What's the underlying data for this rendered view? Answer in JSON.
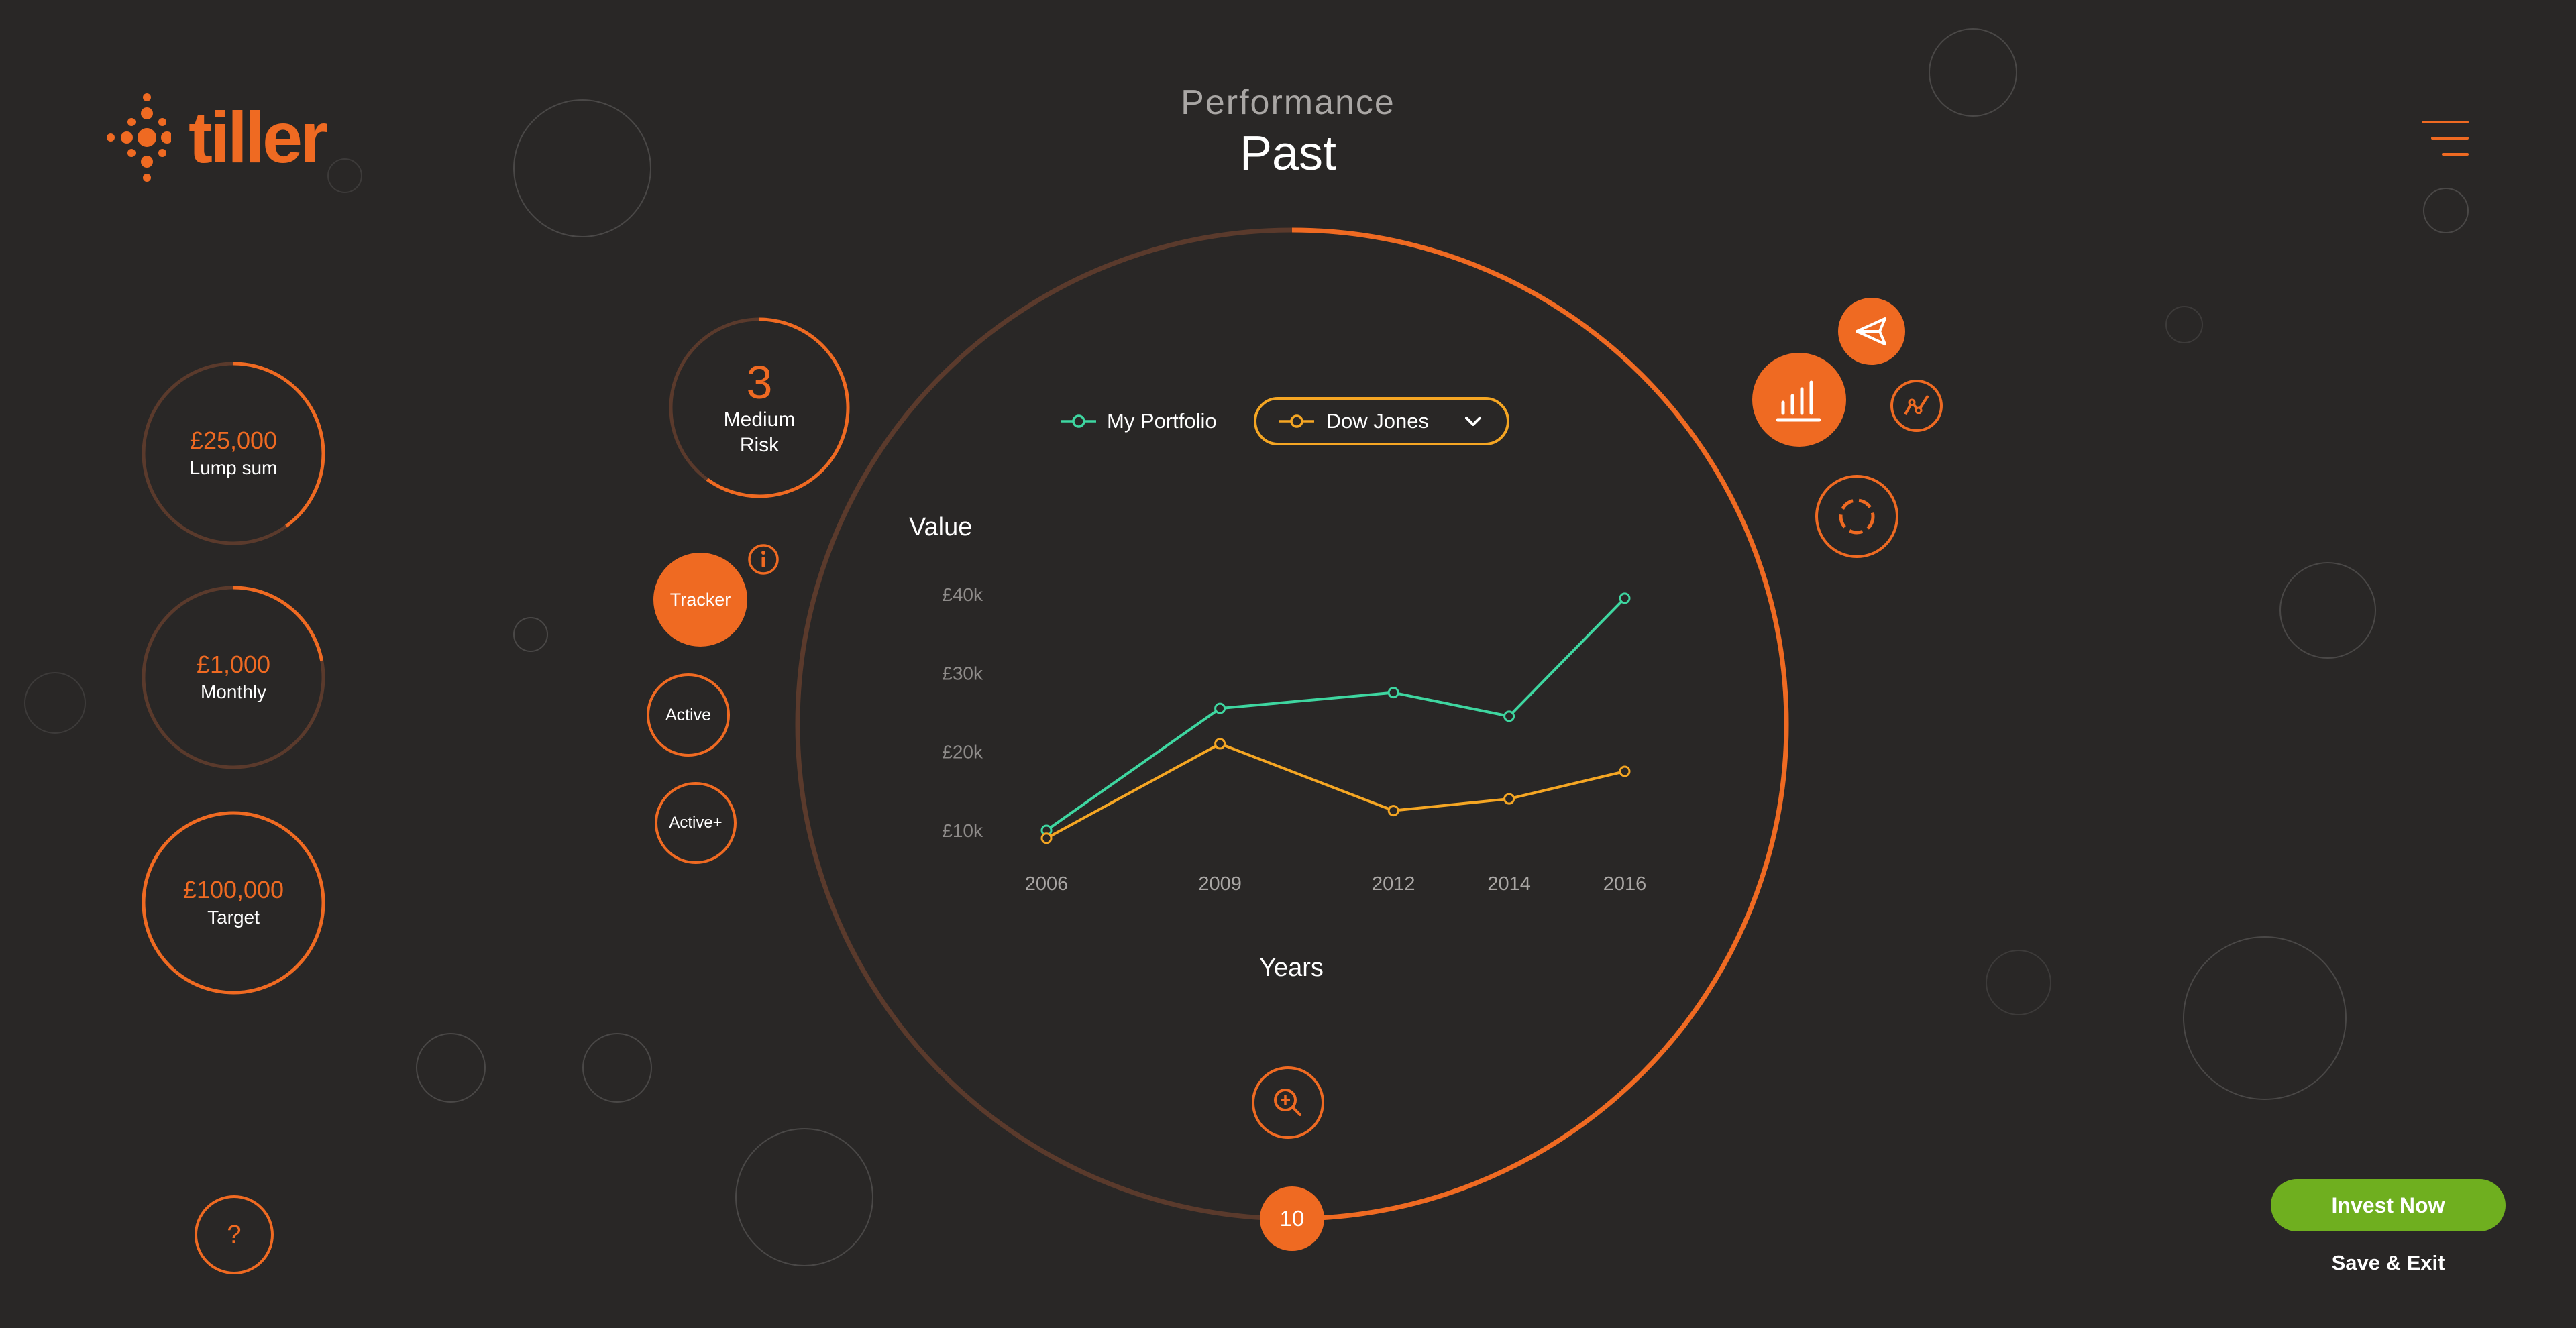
{
  "brand": {
    "name": "tiller",
    "color": "#ef6a22"
  },
  "header": {
    "subtitle": "Performance",
    "title": "Past"
  },
  "inputs": [
    {
      "value": "£25,000",
      "label": "Lump sum",
      "progress": 0.4
    },
    {
      "value": "£1,000",
      "label": "Monthly",
      "progress": 0.22
    },
    {
      "value": "£100,000",
      "label": "Target",
      "progress": 1.0
    }
  ],
  "risk": {
    "level": "3",
    "label_line1": "Medium",
    "label_line2": "Risk",
    "progress": 0.6
  },
  "strategies": [
    {
      "label": "Tracker",
      "selected": true
    },
    {
      "label": "Active",
      "selected": false
    },
    {
      "label": "Active+",
      "selected": false
    }
  ],
  "info_icon": "info-icon",
  "legend": {
    "portfolio_label": "My Portfolio",
    "benchmark_label": "Dow Jones"
  },
  "timeline": {
    "years": "10",
    "progress": 0.5
  },
  "tools": [
    "share-icon",
    "bar-chart-icon",
    "line-chart-icon",
    "loading-icon",
    "zoom-icon"
  ],
  "colors": {
    "accent": "#ef6a22",
    "portfolio": "#3ed6a0",
    "benchmark": "#f5a623",
    "invest": "#6faf1f",
    "background": "#292726"
  },
  "chart_data": {
    "type": "line",
    "ylabel": "Value",
    "xlabel": "Years",
    "x": [
      "2006",
      "2009",
      "2012",
      "2014",
      "2016"
    ],
    "y_ticks": [
      "£10k",
      "£20k",
      "£30k",
      "£40k"
    ],
    "ylim": [
      10000,
      40000
    ],
    "series": [
      {
        "name": "My Portfolio",
        "values": [
          10000,
          25500,
          27500,
          24500,
          39500
        ]
      },
      {
        "name": "Dow Jones",
        "values": [
          9000,
          21000,
          12500,
          14000,
          17500
        ]
      }
    ],
    "grid": false,
    "legend_position": "top"
  },
  "actions": {
    "invest_label": "Invest Now",
    "save_label": "Save & Exit",
    "help_label": "?"
  }
}
